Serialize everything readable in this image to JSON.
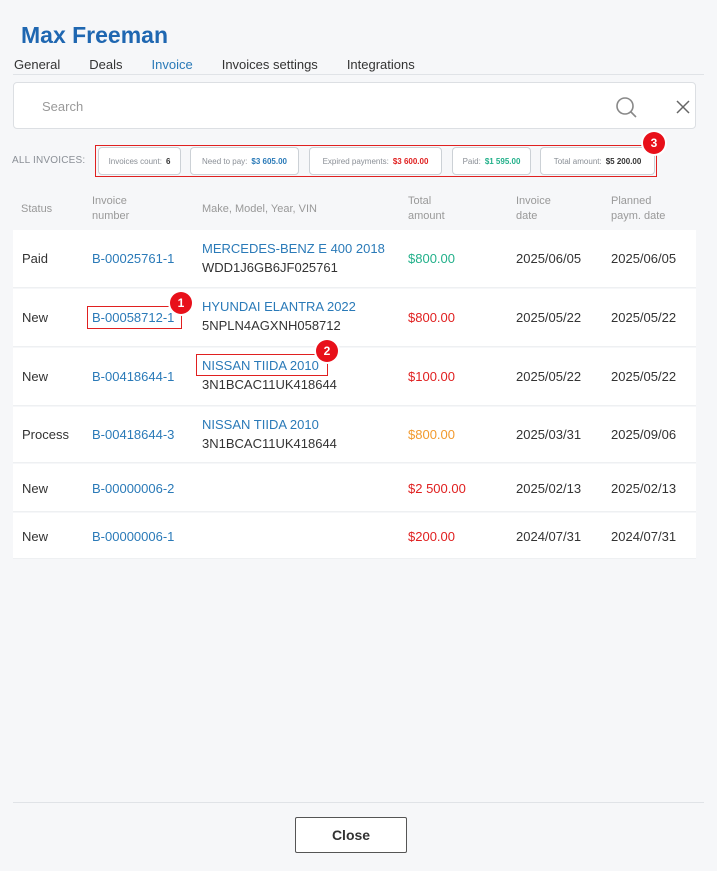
{
  "title": "Max Freeman",
  "tabs": [
    {
      "label": "General"
    },
    {
      "label": "Deals"
    },
    {
      "label": "Invoice"
    },
    {
      "label": "Invoices settings"
    },
    {
      "label": "Integrations"
    }
  ],
  "active_tab": "Invoice",
  "search": {
    "placeholder": "Search",
    "value": ""
  },
  "summary": {
    "label": "ALL INVOICES:",
    "invoices_count": {
      "label": "Invoices count:",
      "value": "6"
    },
    "need_to_pay": {
      "label": "Need to pay:",
      "value": "$3 605.00"
    },
    "expired": {
      "label": "Expired payments:",
      "value": "$3 600.00"
    },
    "paid": {
      "label": "Paid:",
      "value": "$1 595.00"
    },
    "total": {
      "label": "Total amount:",
      "value": "$5 200.00"
    }
  },
  "columns": {
    "status": "Status",
    "invoice_number_1": "Invoice",
    "invoice_number_2": "number",
    "vehicle": "Make, Model, Year, VIN",
    "total_1": "Total",
    "total_2": "amount",
    "date_1": "Invoice",
    "date_2": "date",
    "planned_1": "Planned",
    "planned_2": "paym. date"
  },
  "rows": [
    {
      "status": "Paid",
      "number": "B-00025761-1",
      "vehicle": "MERCEDES-BENZ E 400 2018",
      "vin": "WDD1J6GB6JF025761",
      "amount": "$800.00",
      "date": "2025/06/05",
      "planned": "2025/06/05"
    },
    {
      "status": "New",
      "number": "B-00058712-1",
      "vehicle": "HYUNDAI ELANTRA 2022",
      "vin": "5NPLN4AGXNH058712",
      "amount": "$800.00",
      "date": "2025/05/22",
      "planned": "2025/05/22"
    },
    {
      "status": "New",
      "number": "B-00418644-1",
      "vehicle": "NISSAN TIIDA 2010",
      "vin": "3N1BCAC11UK418644",
      "amount": "$100.00",
      "date": "2025/05/22",
      "planned": "2025/05/22"
    },
    {
      "status": "Process",
      "number": "B-00418644-3",
      "vehicle": "NISSAN TIIDA 2010",
      "vin": "3N1BCAC11UK418644",
      "amount": "$800.00",
      "date": "2025/03/31",
      "planned": "2025/09/06"
    },
    {
      "status": "New",
      "number": "B-00000006-2",
      "vehicle": "",
      "vin": "",
      "amount": "$2 500.00",
      "date": "2025/02/13",
      "planned": "2025/02/13"
    },
    {
      "status": "New",
      "number": "B-00000006-1",
      "vehicle": "",
      "vin": "",
      "amount": "$200.00",
      "date": "2024/07/31",
      "planned": "2024/07/31"
    }
  ],
  "markers": {
    "m1": "1",
    "m2": "2",
    "m3": "3"
  },
  "colors": {
    "brand": "#1f67b1",
    "link": "#2a7ab8",
    "paid": "#22b08a",
    "unpaid": "#e02020",
    "process": "#f29a2e",
    "annotation": "#e8101a"
  },
  "icons": {
    "search": "search-icon",
    "clear": "close-icon"
  },
  "footer": {
    "close_label": "Close"
  }
}
